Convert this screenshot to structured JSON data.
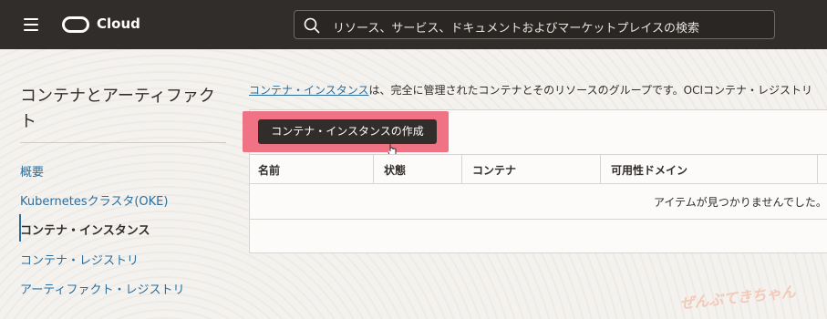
{
  "header": {
    "brand": "Cloud",
    "search_placeholder": "リソース、サービス、ドキュメントおよびマーケットプレイスの検索"
  },
  "sidebar": {
    "title": "コンテナとアーティファクト",
    "items": [
      {
        "label": "概要"
      },
      {
        "label": "Kubernetesクラスタ(OKE)"
      },
      {
        "label": "コンテナ・インスタンス"
      },
      {
        "label": "コンテナ・レジストリ"
      },
      {
        "label": "アーティファクト・レジストリ"
      }
    ],
    "active_index": 2
  },
  "main": {
    "desc_link": "コンテナ・インスタンス",
    "desc_text": "は、完全に管理されたコンテナとそのリソースのグループです。OCIコンテナ・レジストリ",
    "create_button": "コンテナ・インスタンスの作成",
    "table": {
      "columns": [
        "名前",
        "状態",
        "コンテナ",
        "可用性ドメイン"
      ],
      "empty_message": "アイテムが見つかりませんでした。"
    }
  },
  "watermark": "ぜんぶてきちゃん",
  "colors": {
    "topbar": "#312d2a",
    "link": "#2c6e9c",
    "highlight": "#ef7285"
  }
}
